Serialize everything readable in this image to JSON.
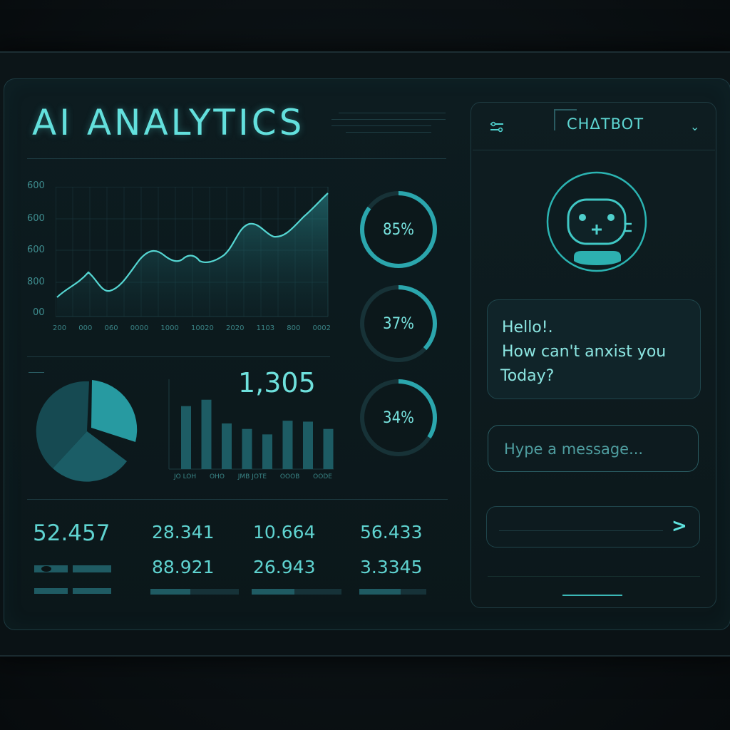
{
  "header": {
    "title": "AI ANALYTICS"
  },
  "line_chart": {
    "y_ticks": [
      "600",
      "600",
      "600",
      "800",
      "00"
    ],
    "x_ticks": [
      "200",
      "000",
      "060",
      "0000",
      "1000",
      "10020",
      "2020",
      "1103",
      "800",
      "0002"
    ]
  },
  "rings": [
    {
      "label": "85%",
      "value": 0.85
    },
    {
      "label": "37%",
      "value": 0.37
    },
    {
      "label": "34%",
      "value": 0.34
    }
  ],
  "bar_chart": {
    "headline": "1,305",
    "labels": [
      "JO LOH",
      "OHO",
      "JMB JOTE",
      "OOOB",
      "OODE"
    ],
    "values": [
      0.69,
      0.76,
      0.5,
      0.44,
      0.38,
      0.53,
      0.52,
      0.44
    ]
  },
  "stats": {
    "primary": "52.457",
    "values": [
      "28.341",
      "10.664",
      "56.433",
      "88.921",
      "26.943",
      "3.3345"
    ]
  },
  "chat": {
    "title": "CHΔTBOT",
    "greeting_line1": "Hello!.",
    "greeting_line2": "How can't anxist you",
    "greeting_line3": "Today?",
    "input_placeholder": "Hype a message...",
    "send_symbol": ">"
  },
  "colors": {
    "accent": "#5fd6d4",
    "background": "#0b1114",
    "panel": "#0d1c20"
  }
}
